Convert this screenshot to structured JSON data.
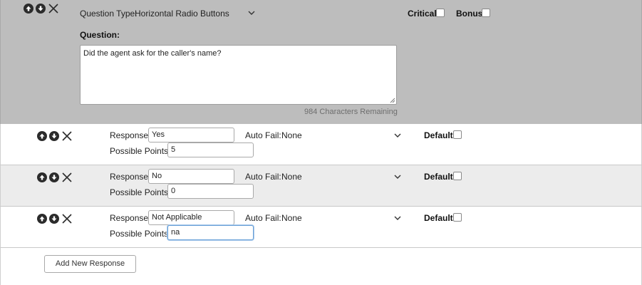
{
  "question": {
    "type_label": "Question Type:",
    "type_value": "Horizontal Radio Buttons",
    "critical_label": "Critical:",
    "bonus_label": "Bonus:",
    "question_label": "Question:",
    "question_text": "Did the agent ask for the caller's name?",
    "remaining": "984 Characters Remaining"
  },
  "responses": [
    {
      "response_label": "Response:",
      "response_value": "Yes",
      "autofail_label": "Auto Fail:",
      "autofail_value": "None",
      "default_label": "Default:",
      "points_label": "Possible Points:",
      "points_value": "5"
    },
    {
      "response_label": "Response:",
      "response_value": "No",
      "autofail_label": "Auto Fail:",
      "autofail_value": "None",
      "default_label": "Default:",
      "points_label": "Possible Points:",
      "points_value": "0"
    },
    {
      "response_label": "Response:",
      "response_value": "Not Applicable",
      "autofail_label": "Auto Fail:",
      "autofail_value": "None",
      "default_label": "Default:",
      "points_label": "Possible Points:",
      "points_value": "na"
    }
  ],
  "add_button_label": "Add New Response",
  "icons": {
    "up": "arrow-up-circle-icon",
    "down": "arrow-down-circle-icon",
    "remove": "close-icon",
    "dropdown": "chevron-down-icon"
  }
}
